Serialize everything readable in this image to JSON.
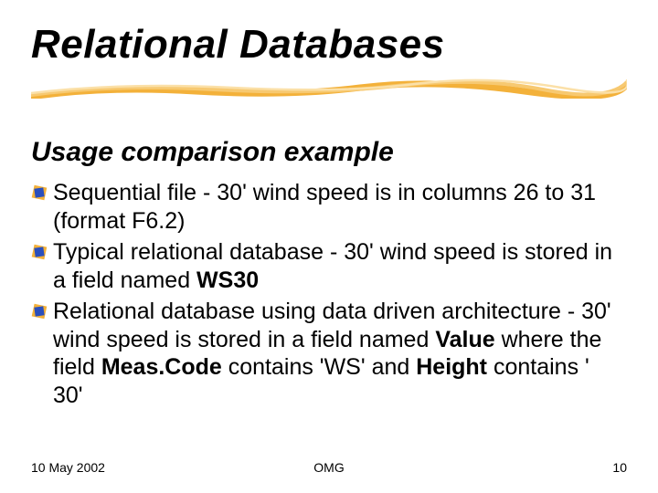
{
  "title": "Relational Databases",
  "subtitle": "Usage comparison example",
  "bullets": {
    "b1_pre": "Sequential file - 30' wind speed is in columns 26 to 31 (format F6.2)",
    "b2_pre": "Typical relational database - 30' wind speed is stored in a field named ",
    "b2_bold1": "WS30",
    "b3_pre": "Relational database using data driven architecture - 30' wind speed is stored in a field named ",
    "b3_bold1": "Value",
    "b3_mid1": " where the field ",
    "b3_bold2": "Meas.Code",
    "b3_mid2": " contains 'WS' and ",
    "b3_bold3": "Height",
    "b3_mid3": " contains ' 30'"
  },
  "footer": {
    "date": "10 May 2002",
    "center": "OMG",
    "page": "10"
  },
  "colors": {
    "accent_orange": "#f3b13a",
    "accent_blue": "#2a4fbd"
  }
}
